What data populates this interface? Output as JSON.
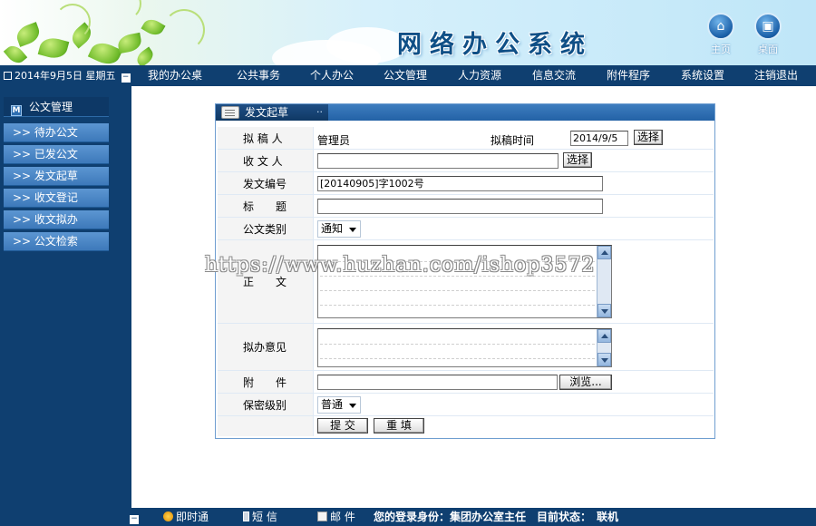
{
  "banner": {
    "title": "网络办公系统",
    "home_label": "主页",
    "desktop_label": "桌面"
  },
  "navbar": {
    "date": "2014年9月5日  星期五",
    "items": [
      "我的办公桌",
      "公共事务",
      "个人办公",
      "公文管理",
      "人力资源",
      "信息交流",
      "附件程序",
      "系统设置",
      "注销退出"
    ]
  },
  "sidebar": {
    "header": "公文管理",
    "items": [
      ">> 待办公文",
      ">> 已发公文",
      ">> 发文起草",
      ">> 收文登记",
      ">> 收文拟办",
      ">> 公文检索"
    ]
  },
  "form": {
    "title": "发文起草",
    "drafter_label": "拟 稿 人",
    "drafter_value": "管理员",
    "draft_time_label": "拟稿时间",
    "draft_time_value": "2014/9/5",
    "select_button": "选择",
    "recipient_label": "收 文 人",
    "recipient_value": "",
    "doc_number_label": "发文编号",
    "doc_number_value": "[20140905]字1002号",
    "subject_label": "标　　题",
    "subject_value": "",
    "category_label": "公文类别",
    "category_value": "通知",
    "body_label": "正　　文",
    "opinion_label": "拟办意见",
    "attachment_label": "附　　件",
    "attachment_value": "",
    "browse_button": "浏览...",
    "secrecy_label": "保密级别",
    "secrecy_value": "普通",
    "submit_button": "提 交",
    "reset_button": "重 填"
  },
  "watermark": "https://www.huzhan.com/ishop3572",
  "footer": {
    "instant": "即时通",
    "sms": "短 信",
    "mail": "邮 件",
    "identity_label": "您的登录身份：集团办公室主任",
    "status_label": "目前状态：",
    "status_value": "联机"
  }
}
